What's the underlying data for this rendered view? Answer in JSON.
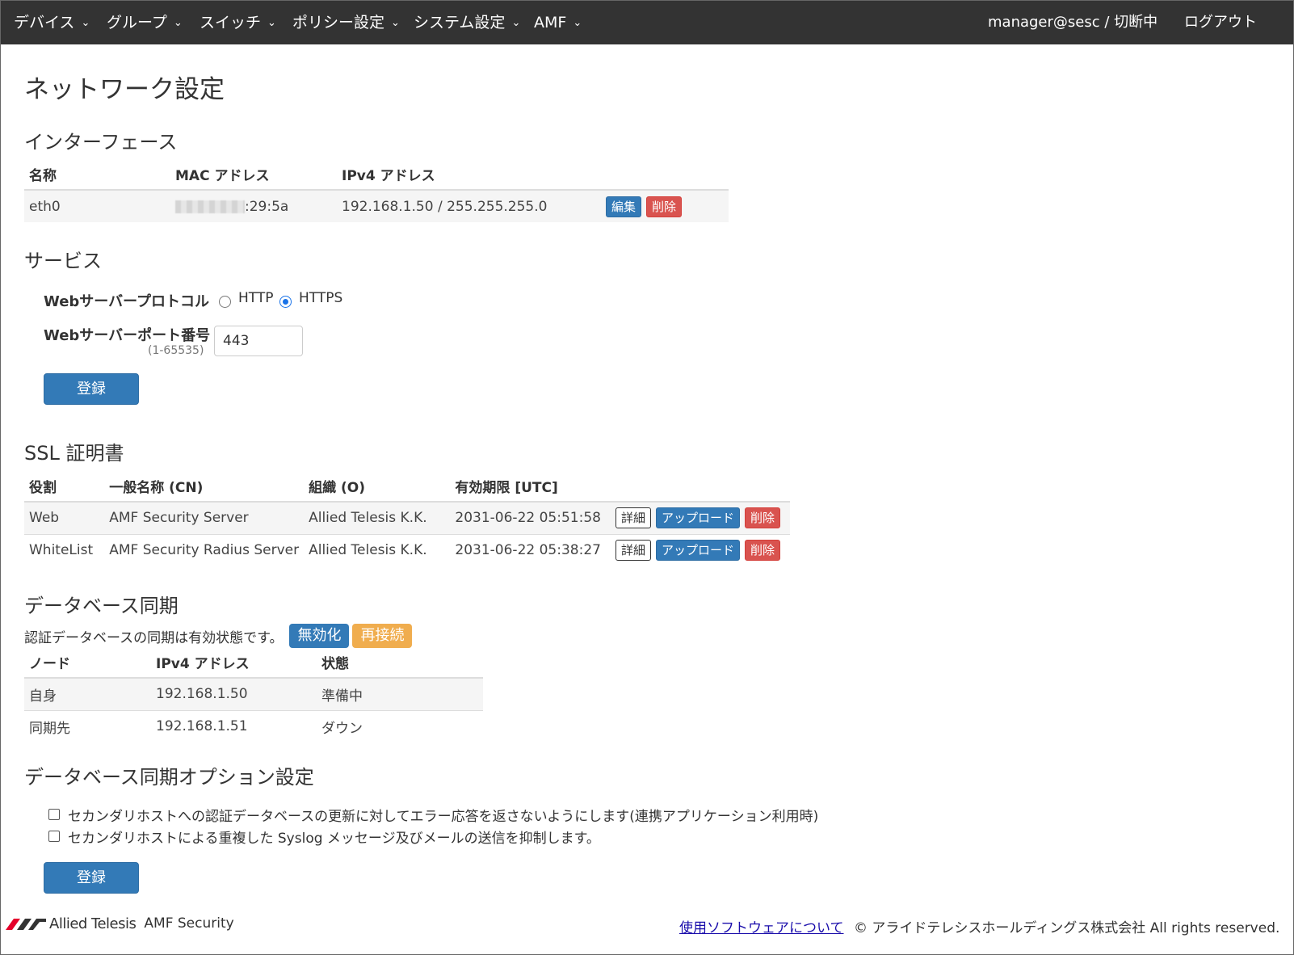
{
  "nav": {
    "items": [
      "デバイス",
      "グループ",
      "スイッチ",
      "ポリシー設定",
      "システム設定",
      "AMF"
    ],
    "user": "manager@sesc",
    "connection": "/ 切断中",
    "logout": "ログアウト"
  },
  "page_title": "ネットワーク設定",
  "interface": {
    "heading": "インターフェース",
    "headers": [
      "名称",
      "MAC アドレス",
      "IPv4 アドレス"
    ],
    "row": {
      "name": "eth0",
      "mac_visible": ":29:5a",
      "ipv4": "192.168.1.50 / 255.255.255.0",
      "edit": "編集",
      "delete": "削除"
    }
  },
  "service": {
    "heading": "サービス",
    "protocol_label": "Webサーバープロトコル",
    "http": "HTTP",
    "https": "HTTPS",
    "selected": "HTTPS",
    "port_label": "Webサーバーポート番号",
    "port_hint": "(1-65535)",
    "port_value": "443",
    "submit": "登録"
  },
  "ssl": {
    "heading": "SSL 証明書",
    "headers": [
      "役割",
      "一般名称 (CN)",
      "組織 (O)",
      "有効期限 [UTC]"
    ],
    "rows": [
      {
        "role": "Web",
        "cn": "AMF Security Server",
        "org": "Allied Telesis K.K.",
        "expiry": "2031-06-22 05:51:58"
      },
      {
        "role": "WhiteList",
        "cn": "AMF Security Radius Server",
        "org": "Allied Telesis K.K.",
        "expiry": "2031-06-22 05:38:27"
      }
    ],
    "detail": "詳細",
    "upload": "アップロード",
    "delete": "削除"
  },
  "dbsync": {
    "heading": "データベース同期",
    "status_text": "認証データベースの同期は有効状態です。",
    "disable": "無効化",
    "reconnect": "再接続",
    "headers": [
      "ノード",
      "IPv4 アドレス",
      "状態"
    ],
    "rows": [
      {
        "node": "自身",
        "ip": "192.168.1.50",
        "state": "準備中"
      },
      {
        "node": "同期先",
        "ip": "192.168.1.51",
        "state": "ダウン"
      }
    ]
  },
  "dbsync_options": {
    "heading": "データベース同期オプション設定",
    "options": [
      "セカンダリホストへの認証データベースの更新に対してエラー応答を返さないようにします(連携アプリケーション利用時)",
      "セカンダリホストによる重複した Syslog メッセージ及びメールの送信を抑制します。"
    ],
    "submit": "登録"
  },
  "footer": {
    "brand": "Allied Telesis",
    "product": "AMF Security",
    "link": "使用ソフトウェアについて",
    "copyright": "© アライドテレシスホールディングス株式会社 All rights reserved."
  },
  "colors": {
    "navbar": "#333333",
    "primary": "#337ab7",
    "danger": "#d9534f",
    "warning": "#f0ad4e"
  }
}
